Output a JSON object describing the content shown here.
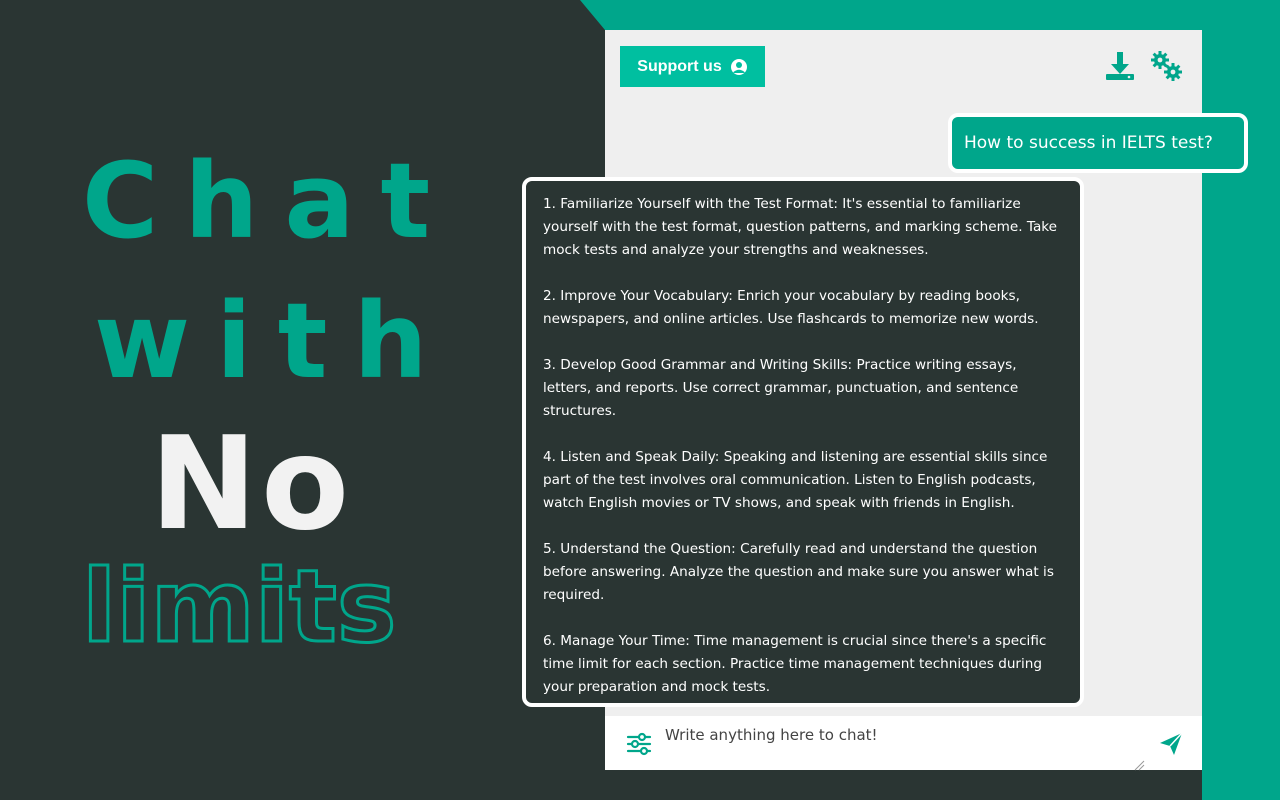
{
  "hero": {
    "line1": "Chat",
    "line2": "with",
    "line3": "No",
    "line4": "limits"
  },
  "header": {
    "support_label": "Support us",
    "icons": [
      "user-circle-icon",
      "download-icon",
      "gears-icon"
    ]
  },
  "conversation": {
    "user_message": "How to success in IELTS test?",
    "bot_paragraphs": [
      "1. Familiarize Yourself with the Test Format: It's essential to familiarize yourself with the test format, question patterns, and marking scheme. Take mock tests and analyze your strengths and weaknesses.",
      "2. Improve Your Vocabulary: Enrich your vocabulary by reading books, newspapers, and online articles. Use flashcards to memorize new words.",
      "3. Develop Good Grammar and Writing Skills: Practice writing essays, letters, and reports. Use correct grammar, punctuation, and sentence structures.",
      "4. Listen and Speak Daily: Speaking and listening are essential skills since part of the test involves oral communication. Listen to English podcasts, watch English movies or TV shows, and speak with friends in English.",
      "5. Understand the Question: Carefully read and understand the question before answering. Analyze the question and make sure you answer what is required.",
      "6. Manage Your Time: Time management is crucial since there's a specific time limit for each section. Practice time management techniques during your preparation and mock tests."
    ]
  },
  "composer": {
    "placeholder": "Write anything here to chat!",
    "icons": [
      "sliders-icon",
      "send-icon"
    ]
  },
  "colors": {
    "accent": "#00a68b",
    "button": "#00bfa0",
    "dark": "#2a3533",
    "window": "#efefef",
    "hero_no": "#f2f2f2"
  }
}
